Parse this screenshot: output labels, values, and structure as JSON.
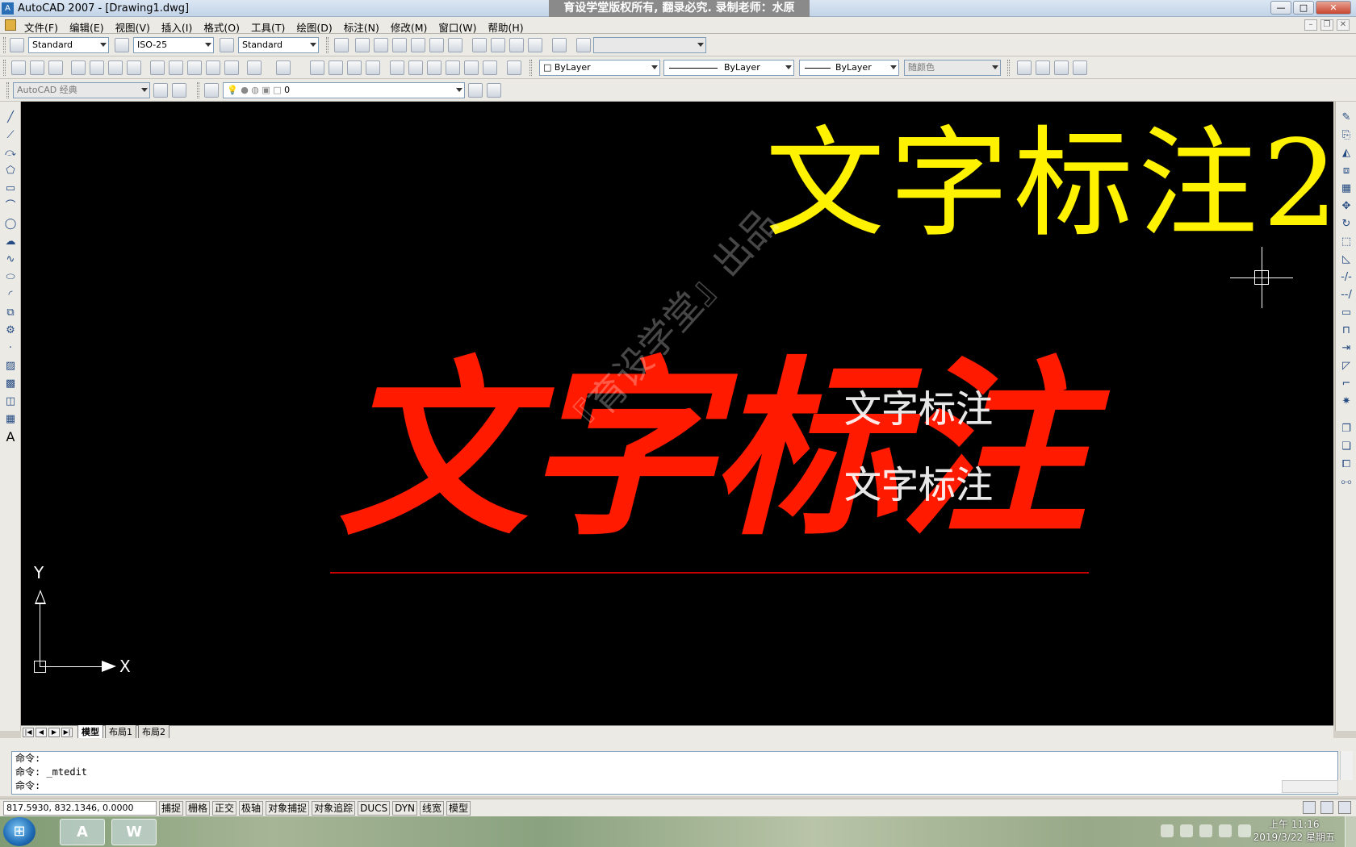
{
  "window": {
    "title": "AutoCAD 2007 - [Drawing1.dwg]",
    "banner": "育设学堂版权所有, 翻录必究. 录制老师：水原",
    "buttons": {
      "minimize": "—",
      "maximize": "□",
      "close": "✕"
    }
  },
  "menu": [
    "文件(F)",
    "编辑(E)",
    "视图(V)",
    "插入(I)",
    "格式(O)",
    "工具(T)",
    "绘图(D)",
    "标注(N)",
    "修改(M)",
    "窗口(W)",
    "帮助(H)"
  ],
  "toolbars": {
    "text_style": "Standard",
    "dim_style": "ISO-25",
    "table_style": "Standard",
    "color": "ByLayer",
    "linetype": "ByLayer",
    "lineweight": "ByLayer",
    "plot_style": "随颜色",
    "workspace": "AutoCAD 经典",
    "layer": "0"
  },
  "canvas": {
    "yellow_text": "文字标注2",
    "red_text": "文字标注",
    "white_text_1": "文字标注",
    "white_text_2": "文字标注",
    "watermark": "『育设学堂』出品",
    "ucs_x": "X",
    "ucs_y": "Y",
    "colors": {
      "background": "#000000",
      "yellow": "#fff200",
      "red": "#ff1a00"
    }
  },
  "tabs": {
    "nav": [
      "|◀",
      "◀",
      "▶",
      "▶|"
    ],
    "items": [
      "模型",
      "布局1",
      "布局2"
    ],
    "active": "模型"
  },
  "command": {
    "lines": [
      "命令:",
      "命令: _mtedit",
      "命令:"
    ]
  },
  "status": {
    "coords": "817.5930, 832.1346, 0.0000",
    "buttons": [
      "捕捉",
      "栅格",
      "正交",
      "极轴",
      "对象捕捉",
      "对象追踪",
      "DUCS",
      "DYN",
      "线宽",
      "模型"
    ]
  },
  "taskbar": {
    "start_icon": "windows-start-icon",
    "apps": [
      "autocad-app",
      "word-app"
    ],
    "time": "上午 11:16",
    "date": "2019/3/22 星期五"
  }
}
